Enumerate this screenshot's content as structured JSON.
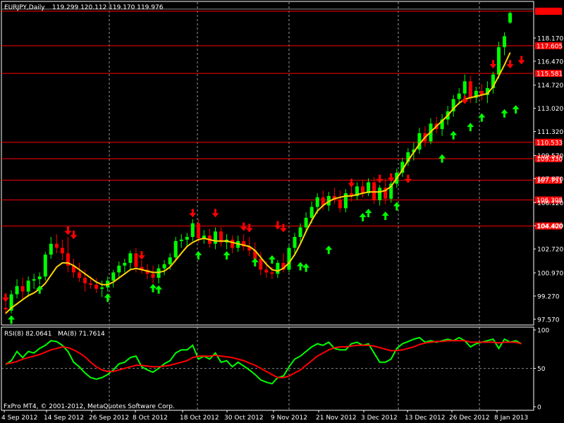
{
  "window": {
    "symbol_label": "EURJPY,Daily",
    "ohlc_label": "119.299 120.112 119.170 119.976",
    "copyright": "FxPro MT4, © 2001-2012, MetaQuotes Software Corp."
  },
  "colors": {
    "background": "#000000",
    "frame": "#ffffff",
    "bull": "#00ff00",
    "bear": "#ff0000",
    "ma": "#ffd400",
    "level_line": "#ff0000",
    "level_label_bg": "#ff0000",
    "current_price_bg": "#ff0000",
    "grid": "#ffffff",
    "rsi": "#00ff00",
    "rsi_ma": "#ff0000",
    "arrow_up": "#00ff00",
    "arrow_down": "#ff0000"
  },
  "chart_data": [
    {
      "type": "candlestick",
      "panel": "price",
      "ylim": [
        97.2,
        120.8
      ],
      "y_ticks": [
        "118.170",
        "116.470",
        "114.720",
        "113.020",
        "111.320",
        "109.570",
        "107.870",
        "106.120",
        "104.420",
        "102.720",
        "100.970",
        "99.270",
        "97.570"
      ],
      "x_date_labels": [
        "4 Sep 2012",
        "14 Sep 2012",
        "26 Sep 2012",
        "8 Oct 2012",
        "18 Oct 2012",
        "30 Oct 2012",
        "9 Nov 2012",
        "21 Nov 2012",
        "3 Dec 2012",
        "13 Dec 2012",
        "26 Dec 2012",
        "8 Jan 2013"
      ],
      "x_label_bar_index": [
        0,
        8,
        16,
        24,
        32,
        40,
        48,
        56,
        64,
        72,
        80,
        88
      ],
      "current_price": "120.132",
      "grid": "vertical dashed",
      "levels": [
        "120.132",
        "117.605",
        "115.581",
        "110.533",
        "109.330",
        "107.751",
        "106.308",
        "104.400"
      ],
      "candles": [
        {
          "o": 98.4,
          "h": 98.9,
          "l": 97.9,
          "c": 98.3
        },
        {
          "o": 98.2,
          "h": 99.7,
          "l": 98.0,
          "c": 99.4
        },
        {
          "o": 99.4,
          "h": 100.5,
          "l": 99.1,
          "c": 100.0
        },
        {
          "o": 100.0,
          "h": 100.6,
          "l": 99.0,
          "c": 99.6
        },
        {
          "o": 99.6,
          "h": 100.7,
          "l": 99.2,
          "c": 100.4
        },
        {
          "o": 100.4,
          "h": 100.9,
          "l": 99.8,
          "c": 100.5
        },
        {
          "o": 100.5,
          "h": 101.0,
          "l": 100.1,
          "c": 100.7
        },
        {
          "o": 100.7,
          "h": 102.5,
          "l": 100.4,
          "c": 102.3
        },
        {
          "o": 102.3,
          "h": 103.6,
          "l": 102.0,
          "c": 103.1
        },
        {
          "o": 103.1,
          "h": 103.8,
          "l": 102.4,
          "c": 102.8
        },
        {
          "o": 102.8,
          "h": 103.4,
          "l": 101.9,
          "c": 102.4
        },
        {
          "o": 102.4,
          "h": 103.6,
          "l": 101.0,
          "c": 101.5
        },
        {
          "o": 101.5,
          "h": 102.0,
          "l": 100.6,
          "c": 101.0
        },
        {
          "o": 101.0,
          "h": 101.7,
          "l": 100.3,
          "c": 100.6
        },
        {
          "o": 100.6,
          "h": 101.2,
          "l": 99.6,
          "c": 100.2
        },
        {
          "o": 100.2,
          "h": 100.7,
          "l": 99.8,
          "c": 100.1
        },
        {
          "o": 100.1,
          "h": 100.6,
          "l": 99.5,
          "c": 99.8
        },
        {
          "o": 99.8,
          "h": 100.4,
          "l": 99.2,
          "c": 99.9
        },
        {
          "o": 99.9,
          "h": 100.7,
          "l": 99.6,
          "c": 100.4
        },
        {
          "o": 100.4,
          "h": 101.2,
          "l": 99.9,
          "c": 101.0
        },
        {
          "o": 101.0,
          "h": 101.8,
          "l": 100.5,
          "c": 101.5
        },
        {
          "o": 101.5,
          "h": 102.0,
          "l": 101.0,
          "c": 101.7
        },
        {
          "o": 101.7,
          "h": 102.6,
          "l": 101.2,
          "c": 102.4
        },
        {
          "o": 102.4,
          "h": 102.8,
          "l": 101.0,
          "c": 101.4
        },
        {
          "o": 101.4,
          "h": 101.9,
          "l": 100.9,
          "c": 101.2
        },
        {
          "o": 101.2,
          "h": 101.6,
          "l": 100.5,
          "c": 100.9
        },
        {
          "o": 100.9,
          "h": 101.5,
          "l": 100.2,
          "c": 100.6
        },
        {
          "o": 100.6,
          "h": 101.6,
          "l": 100.2,
          "c": 101.3
        },
        {
          "o": 101.3,
          "h": 101.9,
          "l": 100.8,
          "c": 101.6
        },
        {
          "o": 101.6,
          "h": 102.4,
          "l": 101.2,
          "c": 102.1
        },
        {
          "o": 102.1,
          "h": 103.6,
          "l": 101.8,
          "c": 103.3
        },
        {
          "o": 103.3,
          "h": 103.8,
          "l": 102.8,
          "c": 103.4
        },
        {
          "o": 103.4,
          "h": 103.9,
          "l": 102.9,
          "c": 103.6
        },
        {
          "o": 103.6,
          "h": 104.9,
          "l": 103.3,
          "c": 104.6
        },
        {
          "o": 104.6,
          "h": 104.9,
          "l": 103.2,
          "c": 103.5
        },
        {
          "o": 103.5,
          "h": 104.1,
          "l": 103.1,
          "c": 103.7
        },
        {
          "o": 103.7,
          "h": 104.2,
          "l": 102.8,
          "c": 103.1
        },
        {
          "o": 103.1,
          "h": 104.3,
          "l": 102.7,
          "c": 104.0
        },
        {
          "o": 104.0,
          "h": 104.3,
          "l": 102.9,
          "c": 103.2
        },
        {
          "o": 103.2,
          "h": 103.8,
          "l": 102.7,
          "c": 103.4
        },
        {
          "o": 103.4,
          "h": 103.7,
          "l": 102.4,
          "c": 102.8
        },
        {
          "o": 102.8,
          "h": 103.7,
          "l": 102.5,
          "c": 103.3
        },
        {
          "o": 103.3,
          "h": 103.8,
          "l": 102.6,
          "c": 102.9
        },
        {
          "o": 102.9,
          "h": 103.6,
          "l": 102.2,
          "c": 102.6
        },
        {
          "o": 102.6,
          "h": 103.2,
          "l": 101.8,
          "c": 102.0
        },
        {
          "o": 102.0,
          "h": 102.5,
          "l": 100.8,
          "c": 101.2
        },
        {
          "o": 101.2,
          "h": 101.8,
          "l": 100.6,
          "c": 101.0
        },
        {
          "o": 101.0,
          "h": 101.4,
          "l": 100.5,
          "c": 100.9
        },
        {
          "o": 100.9,
          "h": 101.9,
          "l": 100.6,
          "c": 101.7
        },
        {
          "o": 101.7,
          "h": 102.4,
          "l": 101.0,
          "c": 101.2
        },
        {
          "o": 101.2,
          "h": 103.0,
          "l": 101.0,
          "c": 102.8
        },
        {
          "o": 102.8,
          "h": 103.9,
          "l": 102.4,
          "c": 103.6
        },
        {
          "o": 103.6,
          "h": 104.6,
          "l": 103.2,
          "c": 104.3
        },
        {
          "o": 104.3,
          "h": 105.4,
          "l": 103.9,
          "c": 105.0
        },
        {
          "o": 105.0,
          "h": 106.2,
          "l": 104.6,
          "c": 105.8
        },
        {
          "o": 105.8,
          "h": 106.8,
          "l": 105.3,
          "c": 106.5
        },
        {
          "o": 106.5,
          "h": 107.0,
          "l": 105.6,
          "c": 105.9
        },
        {
          "o": 105.9,
          "h": 106.9,
          "l": 105.5,
          "c": 106.6
        },
        {
          "o": 106.6,
          "h": 107.2,
          "l": 106.0,
          "c": 106.3
        },
        {
          "o": 106.3,
          "h": 107.0,
          "l": 105.4,
          "c": 105.7
        },
        {
          "o": 105.7,
          "h": 107.1,
          "l": 105.4,
          "c": 106.8
        },
        {
          "o": 106.8,
          "h": 107.4,
          "l": 106.2,
          "c": 106.6
        },
        {
          "o": 106.6,
          "h": 107.6,
          "l": 106.3,
          "c": 107.3
        },
        {
          "o": 107.3,
          "h": 107.8,
          "l": 106.5,
          "c": 106.8
        },
        {
          "o": 106.8,
          "h": 107.9,
          "l": 106.6,
          "c": 107.6
        },
        {
          "o": 107.6,
          "h": 108.0,
          "l": 106.0,
          "c": 106.3
        },
        {
          "o": 106.3,
          "h": 107.4,
          "l": 105.9,
          "c": 107.2
        },
        {
          "o": 107.2,
          "h": 107.9,
          "l": 106.0,
          "c": 106.4
        },
        {
          "o": 106.4,
          "h": 107.8,
          "l": 106.1,
          "c": 107.5
        },
        {
          "o": 107.5,
          "h": 108.6,
          "l": 107.2,
          "c": 108.3
        },
        {
          "o": 108.3,
          "h": 109.4,
          "l": 108.0,
          "c": 109.1
        },
        {
          "o": 109.1,
          "h": 110.1,
          "l": 108.8,
          "c": 109.8
        },
        {
          "o": 109.8,
          "h": 110.5,
          "l": 109.2,
          "c": 110.0
        },
        {
          "o": 110.0,
          "h": 111.6,
          "l": 109.7,
          "c": 111.2
        },
        {
          "o": 111.2,
          "h": 111.7,
          "l": 110.2,
          "c": 110.6
        },
        {
          "o": 110.6,
          "h": 112.3,
          "l": 110.4,
          "c": 111.9
        },
        {
          "o": 111.9,
          "h": 112.4,
          "l": 111.2,
          "c": 111.5
        },
        {
          "o": 111.5,
          "h": 112.6,
          "l": 111.0,
          "c": 112.2
        },
        {
          "o": 112.2,
          "h": 113.2,
          "l": 111.8,
          "c": 112.8
        },
        {
          "o": 112.8,
          "h": 114.0,
          "l": 112.4,
          "c": 113.7
        },
        {
          "o": 113.7,
          "h": 114.5,
          "l": 113.3,
          "c": 114.1
        },
        {
          "o": 114.1,
          "h": 115.5,
          "l": 113.8,
          "c": 115.0
        },
        {
          "o": 115.0,
          "h": 115.4,
          "l": 113.4,
          "c": 113.8
        },
        {
          "o": 113.8,
          "h": 114.6,
          "l": 113.4,
          "c": 114.3
        },
        {
          "o": 114.3,
          "h": 114.8,
          "l": 113.6,
          "c": 114.0
        },
        {
          "o": 114.0,
          "h": 115.0,
          "l": 113.4,
          "c": 114.5
        },
        {
          "o": 114.5,
          "h": 115.7,
          "l": 114.1,
          "c": 115.5
        },
        {
          "o": 115.5,
          "h": 117.9,
          "l": 115.2,
          "c": 117.5
        },
        {
          "o": 117.5,
          "h": 118.6,
          "l": 116.9,
          "c": 118.3
        },
        {
          "o": 119.3,
          "h": 120.1,
          "l": 119.2,
          "c": 120.0
        }
      ],
      "ma_series_name": "",
      "ma": [
        98.0,
        98.4,
        98.7,
        99.0,
        99.3,
        99.5,
        99.8,
        100.2,
        100.8,
        101.4,
        101.7,
        101.7,
        101.5,
        101.2,
        100.9,
        100.6,
        100.3,
        100.1,
        100.1,
        100.3,
        100.6,
        100.9,
        101.2,
        101.3,
        101.2,
        101.1,
        101.0,
        101.0,
        101.1,
        101.4,
        101.9,
        102.4,
        102.9,
        103.2,
        103.4,
        103.5,
        103.4,
        103.3,
        103.3,
        103.3,
        103.2,
        103.1,
        103.0,
        102.9,
        102.6,
        102.1,
        101.6,
        101.2,
        101.1,
        101.3,
        101.7,
        102.3,
        103.1,
        104.0,
        104.8,
        105.5,
        105.9,
        106.2,
        106.4,
        106.5,
        106.6,
        106.6,
        106.7,
        106.8,
        106.9,
        106.9,
        106.9,
        107.0,
        107.3,
        107.9,
        108.5,
        109.2,
        109.8,
        110.4,
        110.9,
        111.3,
        111.7,
        112.1,
        112.5,
        113.0,
        113.4,
        113.7,
        113.8,
        113.9,
        114.0,
        114.1,
        114.6,
        115.4,
        116.2,
        117.1
      ],
      "arrows": [
        {
          "bar": 0,
          "dir": "down",
          "price": 99.2
        },
        {
          "bar": 1,
          "dir": "up",
          "price": 97.5
        },
        {
          "bar": 6,
          "dir": "up",
          "price": 99.7
        },
        {
          "bar": 11,
          "dir": "down",
          "price": 104.1
        },
        {
          "bar": 12,
          "dir": "down",
          "price": 103.8
        },
        {
          "bar": 18,
          "dir": "up",
          "price": 99.1
        },
        {
          "bar": 24,
          "dir": "down",
          "price": 102.3
        },
        {
          "bar": 26,
          "dir": "up",
          "price": 99.8
        },
        {
          "bar": 27,
          "dir": "up",
          "price": 99.7
        },
        {
          "bar": 33,
          "dir": "down",
          "price": 105.4
        },
        {
          "bar": 34,
          "dir": "up",
          "price": 102.2
        },
        {
          "bar": 37,
          "dir": "down",
          "price": 105.4
        },
        {
          "bar": 39,
          "dir": "up",
          "price": 102.2
        },
        {
          "bar": 42,
          "dir": "down",
          "price": 104.4
        },
        {
          "bar": 43,
          "dir": "down",
          "price": 104.3
        },
        {
          "bar": 44,
          "dir": "up",
          "price": 101.7
        },
        {
          "bar": 47,
          "dir": "up",
          "price": 101.9
        },
        {
          "bar": 48,
          "dir": "down",
          "price": 104.5
        },
        {
          "bar": 49,
          "dir": "down",
          "price": 104.3
        },
        {
          "bar": 52,
          "dir": "up",
          "price": 101.4
        },
        {
          "bar": 53,
          "dir": "up",
          "price": 101.3
        },
        {
          "bar": 57,
          "dir": "up",
          "price": 102.6
        },
        {
          "bar": 61,
          "dir": "down",
          "price": 107.6
        },
        {
          "bar": 63,
          "dir": "up",
          "price": 105.0
        },
        {
          "bar": 64,
          "dir": "up",
          "price": 105.3
        },
        {
          "bar": 66,
          "dir": "down",
          "price": 107.9
        },
        {
          "bar": 67,
          "dir": "up",
          "price": 105.1
        },
        {
          "bar": 68,
          "dir": "down",
          "price": 108.0
        },
        {
          "bar": 69,
          "dir": "up",
          "price": 105.8
        },
        {
          "bar": 71,
          "dir": "down",
          "price": 107.9
        },
        {
          "bar": 77,
          "dir": "up",
          "price": 109.3
        },
        {
          "bar": 79,
          "dir": "up",
          "price": 111.0
        },
        {
          "bar": 81,
          "dir": "down",
          "price": 113.7
        },
        {
          "bar": 82,
          "dir": "up",
          "price": 111.6
        },
        {
          "bar": 84,
          "dir": "up",
          "price": 112.3
        },
        {
          "bar": 86,
          "dir": "down",
          "price": 116.3
        },
        {
          "bar": 88,
          "dir": "up",
          "price": 112.6
        },
        {
          "bar": 89,
          "dir": "down",
          "price": 116.3
        },
        {
          "bar": 90,
          "dir": "up",
          "price": 112.9
        },
        {
          "bar": 91,
          "dir": "down",
          "price": 116.6
        }
      ]
    },
    {
      "type": "line",
      "panel": "indicator",
      "label": "RSI(8) 82.0641",
      "label2": "MA(8) 71.7614",
      "ylim": [
        0,
        100
      ],
      "y_ticks": [
        "100",
        "50",
        "0"
      ],
      "level_dashed": 50,
      "series": [
        {
          "values": [
            55,
            60,
            72,
            64,
            72,
            70,
            76,
            80,
            86,
            85,
            80,
            72,
            58,
            52,
            44,
            38,
            36,
            38,
            42,
            48,
            56,
            58,
            64,
            66,
            52,
            48,
            45,
            50,
            56,
            60,
            70,
            74,
            74,
            80,
            62,
            66,
            62,
            70,
            58,
            60,
            52,
            58,
            53,
            48,
            42,
            35,
            32,
            30,
            38,
            40,
            52,
            62,
            66,
            72,
            78,
            82,
            80,
            84,
            76,
            74,
            74,
            82,
            84,
            80,
            82,
            70,
            58,
            58,
            62,
            76,
            82,
            85,
            88,
            90,
            84,
            86,
            84,
            86,
            88,
            86,
            90,
            86,
            78,
            82,
            84,
            86,
            88,
            76,
            88,
            84,
            86,
            82
          ]
        },
        {
          "values": [
            56,
            57,
            59,
            62,
            64,
            66,
            68,
            71,
            74,
            76,
            78,
            77,
            74,
            70,
            65,
            58,
            52,
            48,
            46,
            46,
            48,
            50,
            52,
            54,
            54,
            53,
            52,
            52,
            53,
            54,
            56,
            58,
            60,
            64,
            66,
            66,
            66,
            67,
            66,
            65,
            64,
            62,
            60,
            57,
            54,
            50,
            46,
            42,
            38,
            38,
            40,
            44,
            48,
            54,
            60,
            66,
            70,
            74,
            77,
            78,
            78,
            79,
            80,
            80,
            80,
            79,
            77,
            75,
            73,
            73,
            74,
            76,
            78,
            81,
            83,
            84,
            85,
            85,
            86,
            86,
            86,
            86,
            84,
            84,
            84,
            84,
            84,
            83,
            84,
            84,
            84,
            82
          ]
        }
      ]
    }
  ]
}
